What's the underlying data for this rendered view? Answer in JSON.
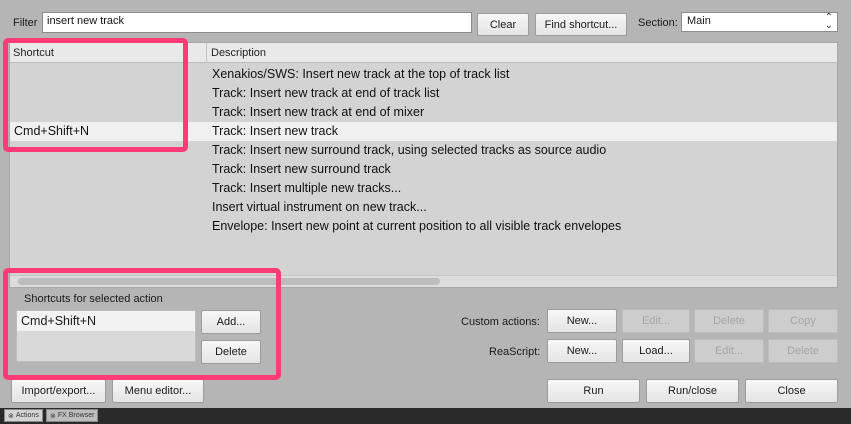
{
  "filter": {
    "label": "Filter",
    "value": "insert new track",
    "clear_label": "Clear",
    "find_shortcut_label": "Find shortcut...",
    "section_label": "Section:",
    "section_value": "Main"
  },
  "table": {
    "columns": [
      "Shortcut",
      "Description"
    ],
    "rows": [
      {
        "shortcut": "",
        "description": "Xenakios/SWS: Insert new track at the top of track list"
      },
      {
        "shortcut": "",
        "description": "Track: Insert new track at end of track list"
      },
      {
        "shortcut": "",
        "description": "Track: Insert new track at end of mixer"
      },
      {
        "shortcut": "Cmd+Shift+N",
        "description": "Track: Insert new track"
      },
      {
        "shortcut": "",
        "description": "Track: Insert new surround track, using selected tracks as source audio"
      },
      {
        "shortcut": "",
        "description": "Track: Insert new surround track"
      },
      {
        "shortcut": "",
        "description": "Track: Insert multiple new tracks..."
      },
      {
        "shortcut": "",
        "description": "Insert virtual instrument on new track..."
      },
      {
        "shortcut": "",
        "description": "Envelope: Insert new point at current position to all visible track envelopes"
      }
    ],
    "selected_row": 3
  },
  "selected_action": {
    "title": "Shortcuts for selected action",
    "shortcuts": [
      "Cmd+Shift+N"
    ],
    "add_label": "Add...",
    "delete_label": "Delete"
  },
  "custom_actions": {
    "label": "Custom actions:",
    "new_label": "New...",
    "edit_label": "Edit...",
    "delete_label": "Delete",
    "copy_label": "Copy"
  },
  "reascript": {
    "label": "ReaScript:",
    "new_label": "New...",
    "load_label": "Load...",
    "edit_label": "Edit...",
    "delete_label": "Delete"
  },
  "footer": {
    "import_export_label": "Import/export...",
    "menu_editor_label": "Menu editor...",
    "run_label": "Run",
    "run_close_label": "Run/close",
    "close_label": "Close"
  },
  "tabs": [
    "Actions",
    "FX Browser"
  ],
  "colors": {
    "highlight": "#ff3b76",
    "window_bg": "#b5b5b5",
    "selected_row": "#f0f0f0"
  }
}
